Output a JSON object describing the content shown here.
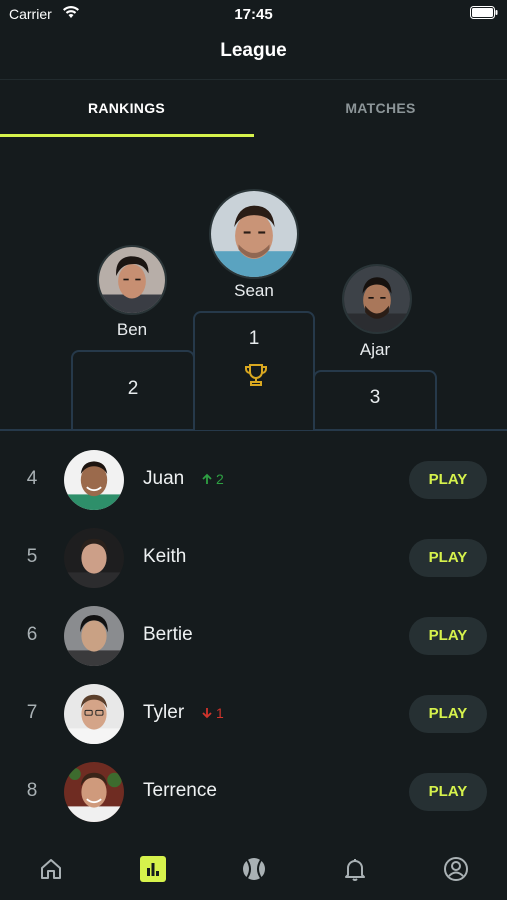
{
  "status_bar": {
    "carrier": "Carrier",
    "time": "17:45"
  },
  "header": {
    "title": "League"
  },
  "tabs": [
    {
      "label": "RANKINGS",
      "active": true
    },
    {
      "label": "MATCHES",
      "active": false
    }
  ],
  "podium": {
    "first": {
      "name": "Sean",
      "place": "1"
    },
    "second": {
      "name": "Ben",
      "place": "2"
    },
    "third": {
      "name": "Ajar",
      "place": "3"
    }
  },
  "rankings": [
    {
      "rank": "4",
      "name": "Juan",
      "trend": "up",
      "trend_value": "2",
      "play_label": "PLAY"
    },
    {
      "rank": "5",
      "name": "Keith",
      "trend": "",
      "trend_value": "",
      "play_label": "PLAY"
    },
    {
      "rank": "6",
      "name": "Bertie",
      "trend": "",
      "trend_value": "",
      "play_label": "PLAY"
    },
    {
      "rank": "7",
      "name": "Tyler",
      "trend": "down",
      "trend_value": "1",
      "play_label": "PLAY"
    },
    {
      "rank": "8",
      "name": "Terrence",
      "trend": "",
      "trend_value": "",
      "play_label": "PLAY"
    }
  ],
  "bottom_nav": [
    {
      "icon": "home-icon",
      "active": false
    },
    {
      "icon": "leaderboard-icon",
      "active": true
    },
    {
      "icon": "tennis-ball-icon",
      "active": false
    },
    {
      "icon": "bell-icon",
      "active": false
    },
    {
      "icon": "profile-icon",
      "active": false
    }
  ],
  "colors": {
    "background": "#151b1d",
    "accent": "#d6f24c",
    "podium_border": "#26394a",
    "trend_up": "#2ea043",
    "trend_down": "#d0342c",
    "trophy": "#d9a821"
  }
}
